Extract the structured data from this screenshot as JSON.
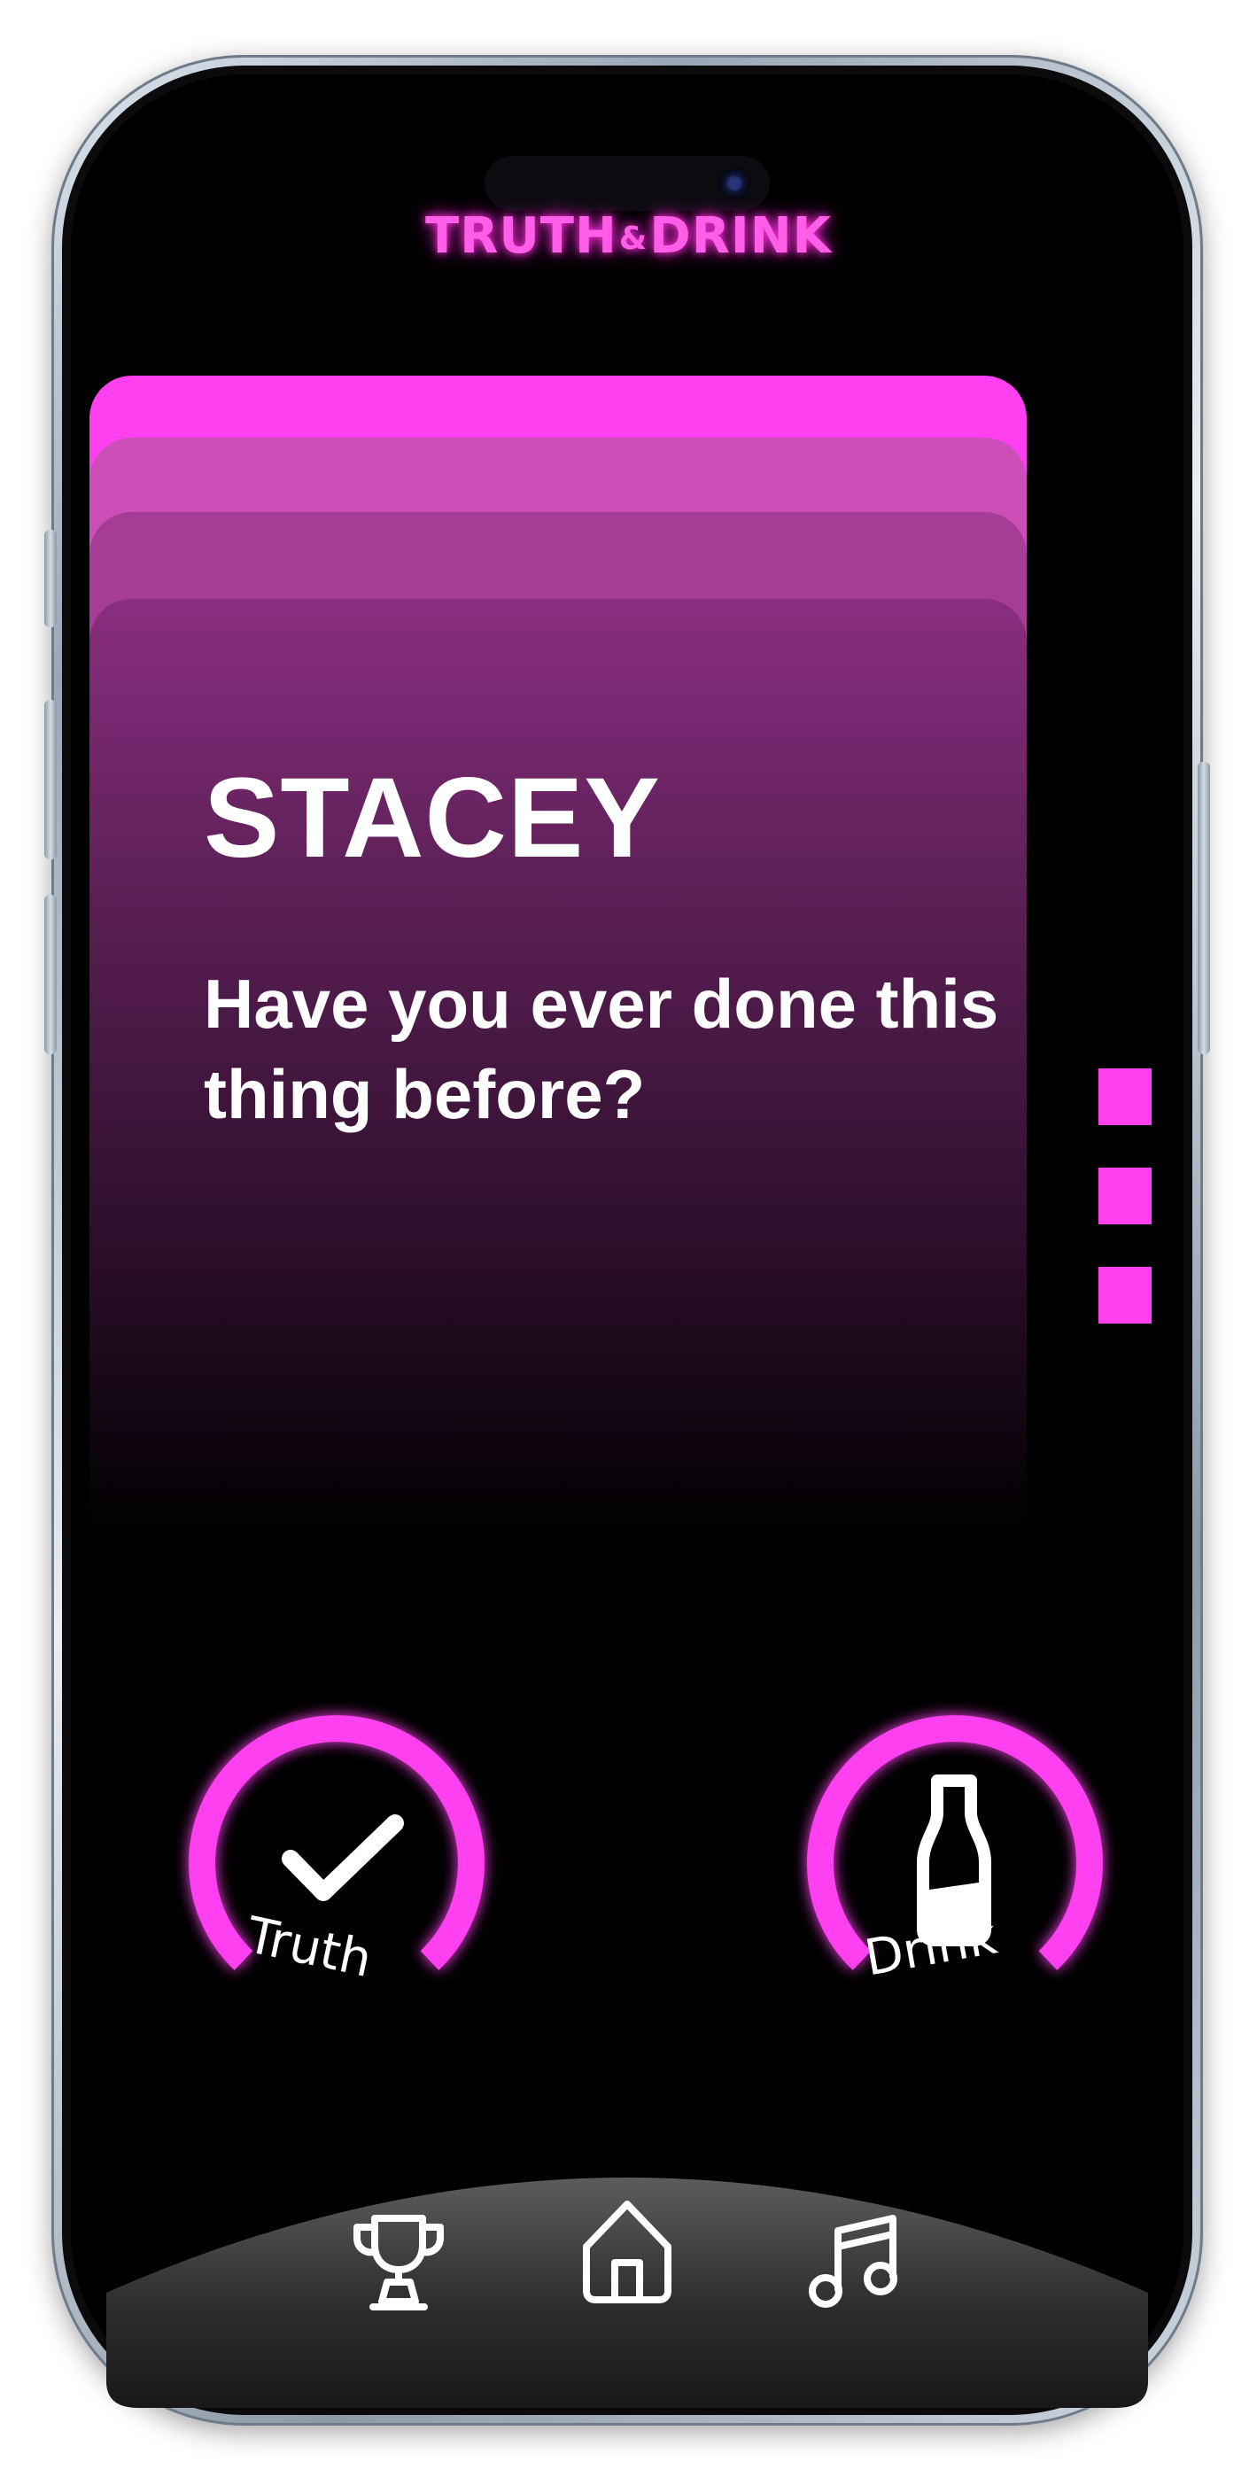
{
  "app": {
    "logo_left": "TRUTH",
    "logo_amp": "&",
    "logo_right": "DRINK",
    "accent_color": "#ff3ff0"
  },
  "card": {
    "player_name": "STACEY",
    "question": "Have you ever done this thing before?"
  },
  "actions": {
    "truth_label": "Truth",
    "drink_label": "Drink"
  },
  "nav": {
    "items": [
      {
        "icon": "trophy-icon"
      },
      {
        "icon": "home-icon"
      },
      {
        "icon": "music-note-icon"
      }
    ]
  }
}
